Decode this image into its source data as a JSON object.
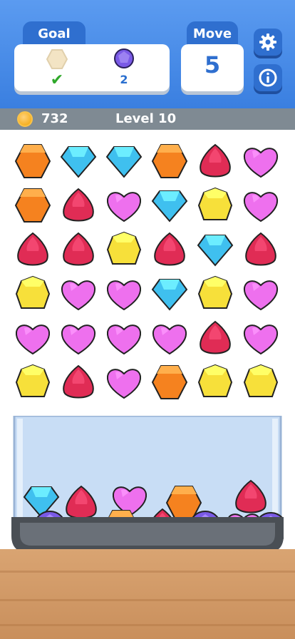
{
  "header": {
    "goal_label": "Goal",
    "move_label": "Move",
    "goals": [
      {
        "gem": "orange-hexagon",
        "status": "complete"
      },
      {
        "gem": "purple-round",
        "count": "2"
      }
    ],
    "moves": "5",
    "settings_icon": "gear-icon",
    "info_icon": "info-icon"
  },
  "status_bar": {
    "coins": "732",
    "level": "Level 10"
  },
  "colors": {
    "orange": "#f5821f",
    "blue": "#3fc0ef",
    "red": "#e02c55",
    "pink": "#ee70ee",
    "yellow": "#f7e03a",
    "purple": "#7a5ae6"
  },
  "board": [
    [
      "orange",
      "blue",
      "blue",
      "orange",
      "red",
      "pink"
    ],
    [
      "orange",
      "red",
      "pink",
      "blue",
      "yellow",
      "pink"
    ],
    [
      "red",
      "red",
      "yellow",
      "red",
      "blue",
      "red"
    ],
    [
      "yellow",
      "pink",
      "pink",
      "blue",
      "yellow",
      "pink"
    ],
    [
      "pink",
      "pink",
      "pink",
      "pink",
      "red",
      "pink"
    ],
    [
      "yellow",
      "red",
      "pink",
      "orange",
      "yellow",
      "yellow"
    ]
  ],
  "jar_contents": [
    "blue",
    "red",
    "pink",
    "orange",
    "red",
    "purple",
    "blue",
    "orange",
    "red",
    "purple",
    "pink",
    "purple"
  ]
}
